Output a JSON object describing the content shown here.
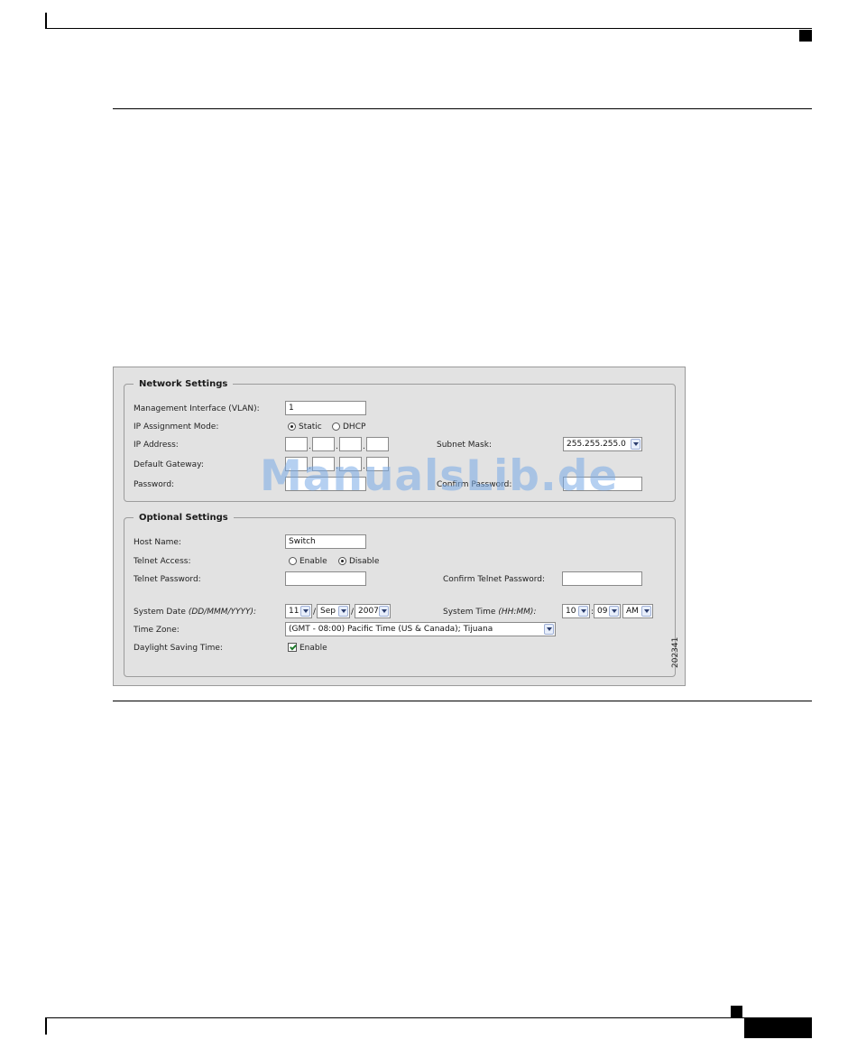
{
  "network_settings": {
    "legend": "Network Settings",
    "mgmt_interface_label": "Management Interface (VLAN):",
    "mgmt_interface_value": "1",
    "ip_mode_label": "IP Assignment Mode:",
    "ip_mode_static": "Static",
    "ip_mode_dhcp": "DHCP",
    "ip_mode_selected": "Static",
    "ip_address_label": "IP Address:",
    "ip_address_octets": [
      "",
      "",
      "",
      ""
    ],
    "subnet_mask_label": "Subnet Mask:",
    "subnet_mask_value": "255.255.255.0",
    "default_gateway_label": "Default Gateway:",
    "default_gateway_octets": [
      "",
      "",
      "",
      ""
    ],
    "password_label": "Password:",
    "confirm_password_label": "Confirm Password:"
  },
  "optional_settings": {
    "legend": "Optional Settings",
    "host_name_label": "Host Name:",
    "host_name_value": "Switch",
    "telnet_access_label": "Telnet Access:",
    "telnet_enable": "Enable",
    "telnet_disable": "Disable",
    "telnet_selected": "Disable",
    "telnet_password_label": "Telnet Password:",
    "confirm_telnet_password_label": "Confirm Telnet Password:",
    "system_date_label": "System Date",
    "system_date_format": "(DD/MMM/YYYY):",
    "date_day": "11",
    "date_month": "Sep",
    "date_year": "2007",
    "system_time_label": "System Time",
    "system_time_format": "(HH:MM):",
    "time_hour": "10",
    "time_minute": "09",
    "time_ampm": "AM",
    "time_zone_label": "Time Zone:",
    "time_zone_value": "(GMT - 08:00) Pacific Time (US & Canada); Tijuana",
    "dst_label": "Daylight Saving Time:",
    "dst_enable": "Enable",
    "dst_checked": true
  },
  "figure_number": "202341",
  "watermark": "ManualsLib.de"
}
